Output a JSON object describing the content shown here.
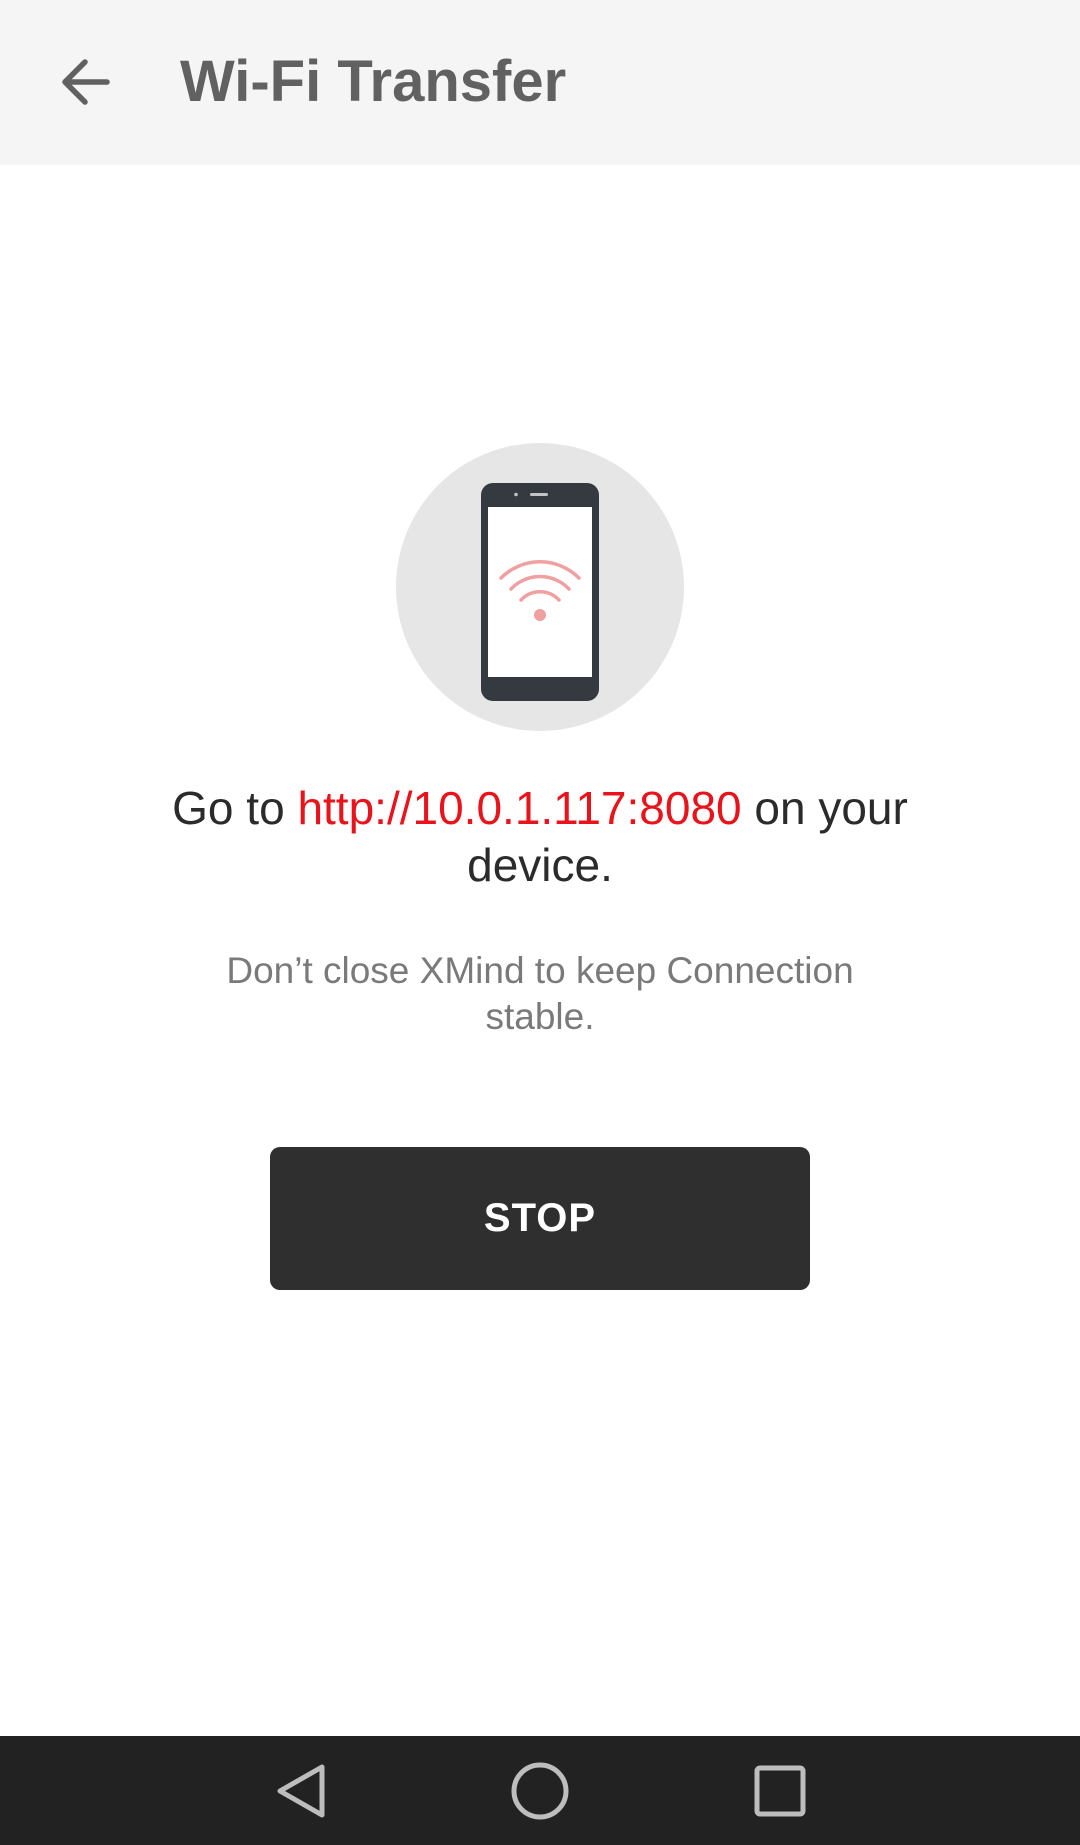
{
  "appbar": {
    "title": "Wi-Fi Transfer",
    "back_icon": "arrow-back-icon"
  },
  "illustration": {
    "icon": "phone-wifi-icon",
    "colors": {
      "circle": "#e6e6e6",
      "phone": "#353a41",
      "wifi": "#f0a0a0"
    }
  },
  "instruction": {
    "prefix": "Go to ",
    "url": "http://10.0.1.117:8080",
    "suffix": " on your device."
  },
  "note": "Don’t close XMind to keep Connection stable.",
  "stop_label": "STOP",
  "colors": {
    "accent": "#e8131b",
    "button": "#2f2f2f",
    "navbar": "#222222"
  },
  "navbar": {
    "back_icon": "nav-back-icon",
    "home_icon": "nav-home-icon",
    "recents_icon": "nav-recents-icon"
  }
}
